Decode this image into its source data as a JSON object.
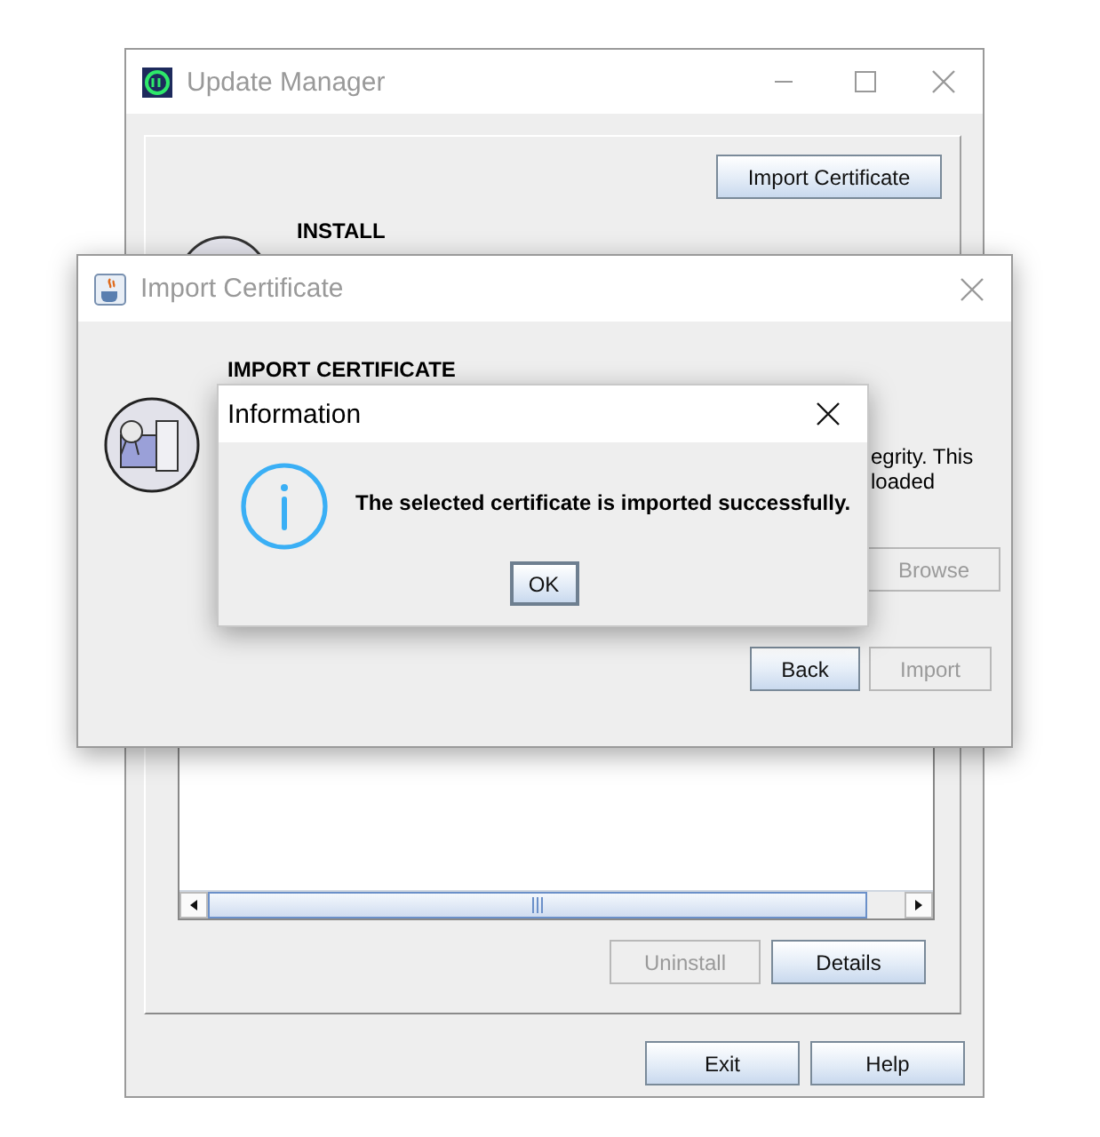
{
  "update_manager": {
    "title": "Update Manager",
    "active": false,
    "import_button": {
      "label": "Import Certificate",
      "disabled": false
    },
    "section_title": "INSTALL",
    "buttons": [
      {
        "label": "Uninstall",
        "disabled": true
      },
      {
        "label": "Details",
        "disabled": false
      }
    ],
    "footer_buttons": [
      {
        "label": "Exit",
        "disabled": false
      },
      {
        "label": "Help",
        "disabled": false
      }
    ]
  },
  "import_certificate": {
    "title": "Import Certificate",
    "active": false,
    "heading": "IMPORT CERTIFICATE",
    "description_lines": [
      "egrity. This",
      "loaded"
    ],
    "browse_button": {
      "label": "Browse",
      "disabled": true
    },
    "buttons": [
      {
        "label": "Back",
        "disabled": false
      },
      {
        "label": "Import",
        "disabled": true
      }
    ]
  },
  "information": {
    "title": "Information",
    "active": true,
    "message": "The selected certificate is imported successfully.",
    "ok_button": {
      "label": "OK",
      "disabled": false
    }
  }
}
